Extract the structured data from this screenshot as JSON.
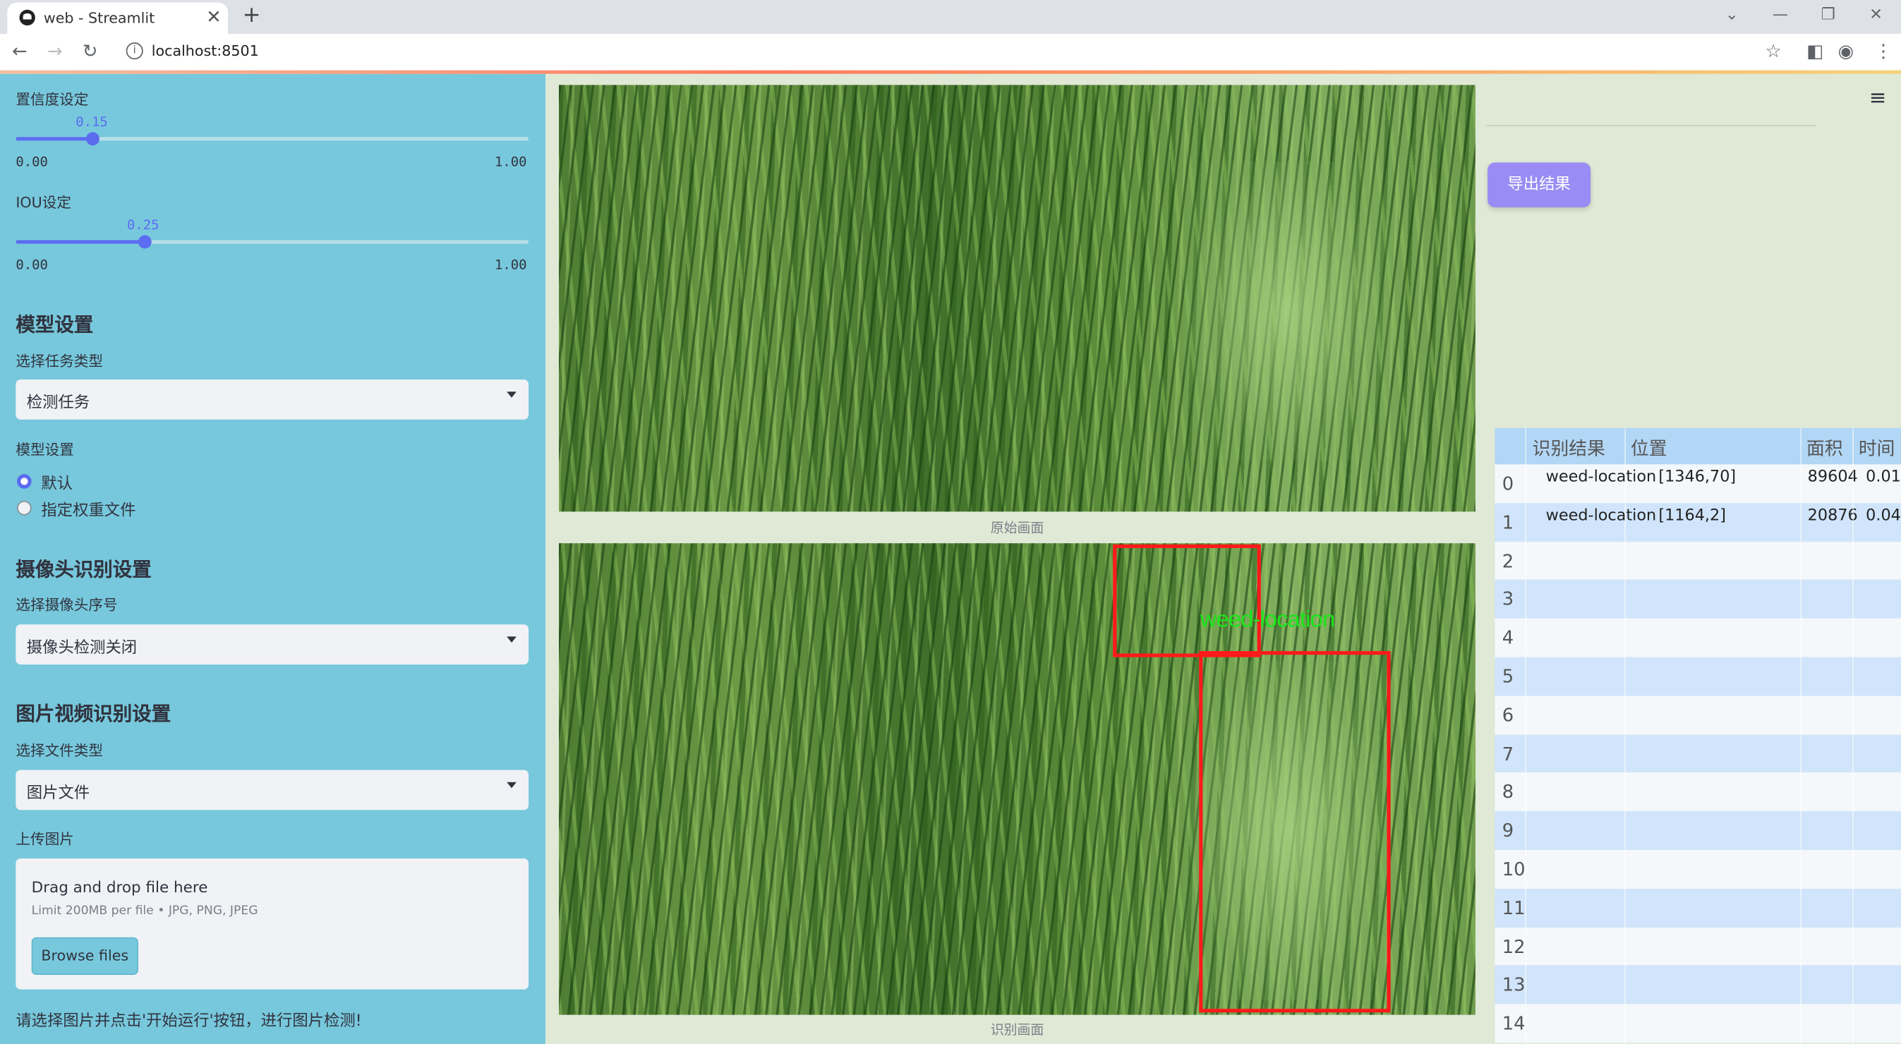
{
  "browser": {
    "tab_title": "web - Streamlit",
    "new_tab": "+",
    "close_tab": "✕",
    "url": "localhost:8501"
  },
  "sidebar": {
    "confidence": {
      "label": "置信度设定",
      "value": "0.15",
      "min": "0.00",
      "max": "1.00",
      "fraction": 0.15
    },
    "iou": {
      "label": "IOU设定",
      "value": "0.25",
      "min": "0.00",
      "max": "1.00",
      "fraction": 0.25
    },
    "model_header": "模型设置",
    "task_label": "选择任务类型",
    "task_value": "检测任务",
    "model_label": "模型设置",
    "model_options": [
      "默认",
      "指定权重文件"
    ],
    "model_selected": "默认",
    "camera_header": "摄像头识别设置",
    "camera_label": "选择摄像头序号",
    "camera_value": "摄像头检测关闭",
    "media_header": "图片视频识别设置",
    "filetype_label": "选择文件类型",
    "filetype_value": "图片文件",
    "upload_label": "上传图片",
    "upload_drag": "Drag and drop file here",
    "upload_limit": "Limit 200MB per file • JPG, PNG, JPEG",
    "browse_button": "Browse files",
    "note": "请选择图片并点击'开始运行'按钮，进行图片检测!"
  },
  "main": {
    "original_caption": "原始画面",
    "result_caption": "识别画面",
    "detection_label": "weed-location",
    "export_button": "导出结果"
  },
  "table": {
    "headers": [
      "识别结果",
      "位置",
      "面积",
      "时间"
    ],
    "rows": [
      {
        "idx": "0",
        "result": "weed-location",
        "position": "[1346,70]",
        "area": "89604",
        "time": "0.01"
      },
      {
        "idx": "1",
        "result": "weed-location",
        "position": "[1164,2]",
        "area": "20876",
        "time": "0.04"
      },
      {
        "idx": "2"
      },
      {
        "idx": "3"
      },
      {
        "idx": "4"
      },
      {
        "idx": "5"
      },
      {
        "idx": "6"
      },
      {
        "idx": "7"
      },
      {
        "idx": "8"
      },
      {
        "idx": "9"
      },
      {
        "idx": "10"
      },
      {
        "idx": "11"
      },
      {
        "idx": "12"
      },
      {
        "idx": "13"
      },
      {
        "idx": "14"
      }
    ]
  },
  "colors": {
    "sidebar": "#77c8dc",
    "accent": "#5b6cf0",
    "export": "#9a8cf4",
    "box": "#ff1a1a",
    "box_label": "#19e619"
  }
}
